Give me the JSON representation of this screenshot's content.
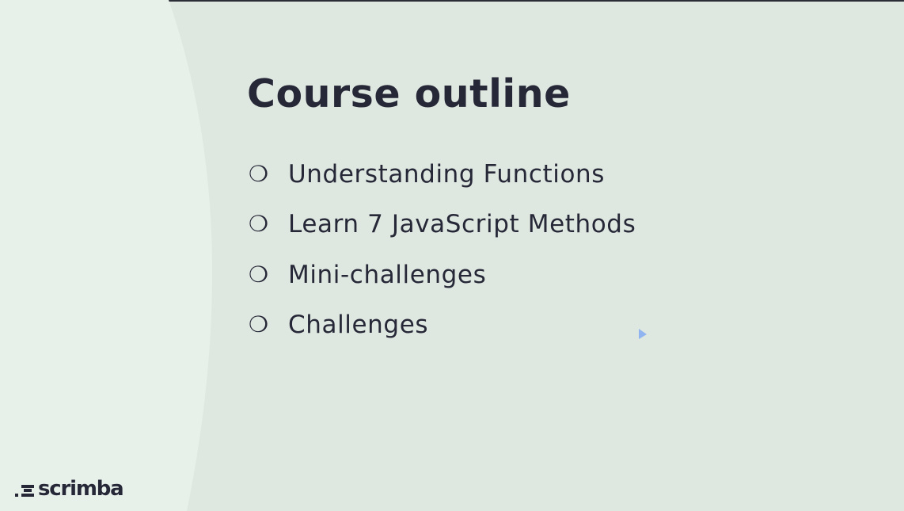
{
  "slide": {
    "title": "Course outline",
    "bullet_icon": "hollow-circle-bullet",
    "items": [
      {
        "label": "Understanding Functions"
      },
      {
        "label": "Learn 7 JavaScript Methods"
      },
      {
        "label": "Mini-challenges"
      },
      {
        "label": "Challenges"
      }
    ]
  },
  "brand": {
    "logo_text": "scrimba",
    "logo_icon": "scrimba-logo-mark"
  },
  "colors": {
    "background": "#dfe8e0",
    "panel_light": "#e8f0ea",
    "text": "#262838",
    "cursor": "#8fb4f0"
  },
  "cursor": {
    "icon": "mouse-pointer-icon"
  }
}
